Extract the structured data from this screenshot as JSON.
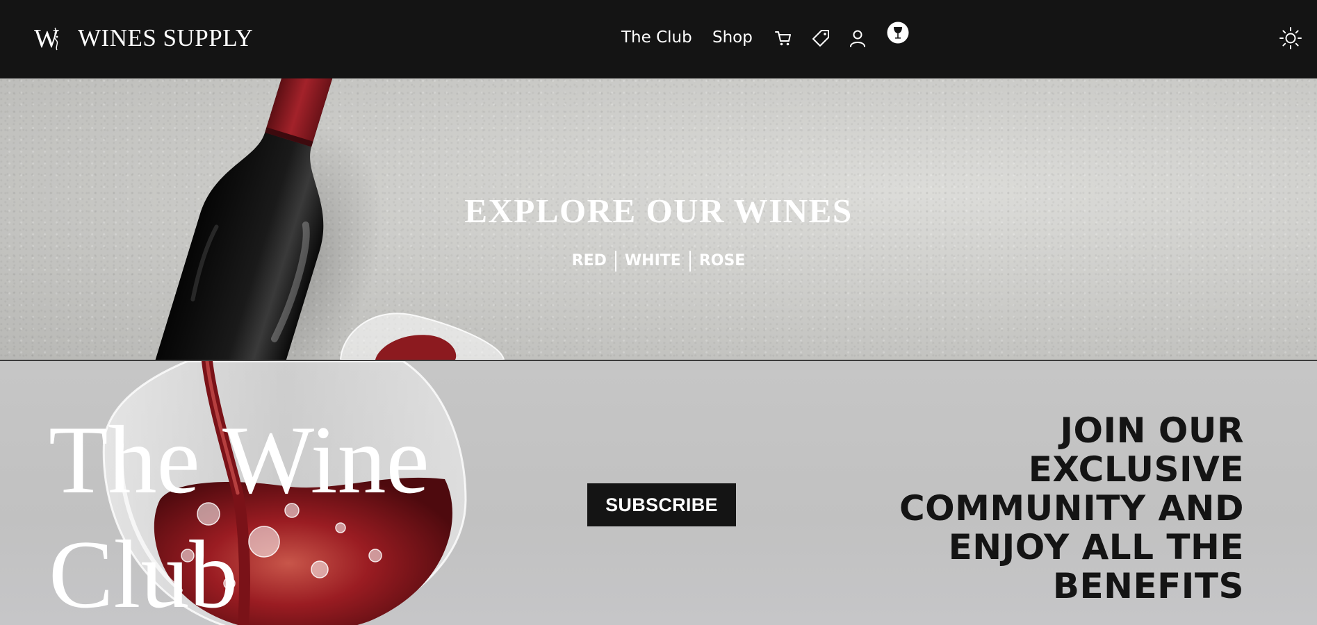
{
  "header": {
    "brand_name": "WINES SUPPLY",
    "nav": {
      "club_label": "The Club",
      "shop_label": "Shop"
    },
    "icons": [
      "w-logo-icon",
      "cart-icon",
      "tag-icon",
      "user-icon",
      "wine-glass-icon",
      "sun-icon"
    ]
  },
  "hero": {
    "title": "EXPLORE OUR WINES",
    "links": [
      "RED",
      "WHITE",
      "ROSE"
    ]
  },
  "club": {
    "title_line_1": "The Wine",
    "title_line_2": "Club",
    "subscribe_label": "SUBSCRIBE",
    "tagline_lines": [
      "JOIN OUR",
      "EXCLUSIVE",
      "COMMUNITY AND",
      "ENJOY ALL THE",
      "BENEFITS"
    ]
  },
  "colors": {
    "header_bg": "#141414",
    "button_bg": "#141414",
    "hero_text": "#ffffff",
    "tagline_text": "#141414",
    "wine_red": "#8c1a1f"
  }
}
